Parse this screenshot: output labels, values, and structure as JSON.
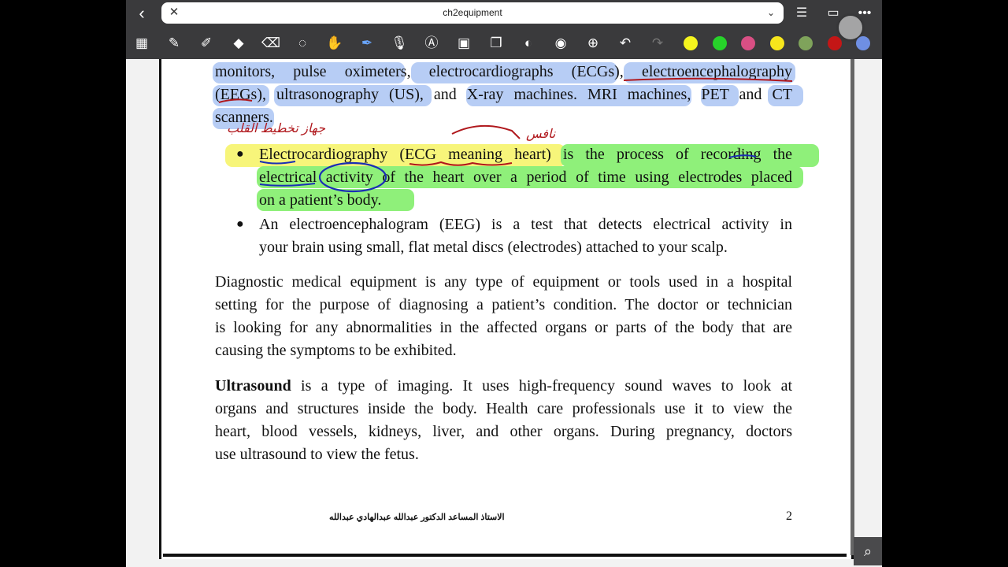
{
  "window": {
    "tab_title": "ch2equipment"
  },
  "toolbar": {
    "tools": [
      "grid-icon",
      "pen-icon",
      "highlighter-icon",
      "shapes-icon",
      "eraser-icon",
      "lasso-icon",
      "hand-icon",
      "laser-icon",
      "mic-icon",
      "textbox-icon",
      "image-icon",
      "copy-icon",
      "sticker-icon",
      "camera-icon",
      "add-icon",
      "undo-icon",
      "redo-icon"
    ],
    "colors": [
      "#f5f51e",
      "#27d22a",
      "#d94f84",
      "#f7e61c",
      "#7fa35b",
      "#c41616",
      "#6f8fe3"
    ]
  },
  "document": {
    "line1_a": "monitors, pulse oximeters, electrocardiographs (ECGs), electroencephalography",
    "line2": "(EEGs), ultrasonography (US), and X-ray machines. MRI machines, PET and CT",
    "line3": "scanners.",
    "bullet1_l1": "Electrocardiography (ECG meaning heart) is the process of recording the",
    "bullet1_l2": "electrical activity of the heart over a period of time using electrodes placed",
    "bullet1_l3": "on a patient’s body.",
    "bullet2_l1": "An electroencephalogram (EEG) is a test that detects electrical activity in",
    "bullet2_l2": "your brain using small, flat metal discs (electrodes) attached to your scalp.",
    "para1_l1": "Diagnostic medical equipment is any type of equipment or tools used in a hospital",
    "para1_l2": "setting for the purpose of diagnosing a patient’s condition. The doctor or technician",
    "para1_l3": "is looking for any abnormalities in the affected organs or parts of the body that are",
    "para1_l4": "causing the symptoms to be exhibited.",
    "para2_bold": "Ultrasound",
    "para2_l1": " is a type of imaging. It uses high-frequency sound waves to look at",
    "para2_l2": "organs and structures inside the body. Health care professionals use it to view the",
    "para2_l3": "heart, blood vessels, kidneys, liver, and other organs. During pregnancy, doctors",
    "para2_l4": "use ultrasound to view the fetus.",
    "footer_author": "الاستاذ المساعد الدكتور عبدالله عبدالهادي عبدالله",
    "page_number": "2"
  },
  "annotations": {
    "note_left": "جهاز تخطيط القلب",
    "note_right": "نافس"
  }
}
